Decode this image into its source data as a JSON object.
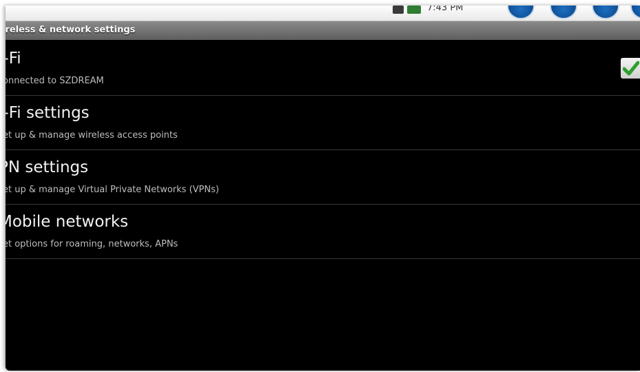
{
  "status_bar": {
    "time": "7:43 PM",
    "icons": [
      "sd-card-icon",
      "battery-icon",
      "nav-circle-icon",
      "nav-circle-icon",
      "nav-circle-icon",
      "nav-circle-icon"
    ]
  },
  "screen": {
    "title": "ireless & network settings"
  },
  "settings": [
    {
      "title": "i-Fi",
      "summary": "onnected to SZDREAM",
      "checked": true
    },
    {
      "title": "i-Fi settings",
      "summary": "et up & manage wireless access points"
    },
    {
      "title": "PN settings",
      "summary": "et up & manage Virtual Private Networks (VPNs)"
    },
    {
      "title": "Mobile networks",
      "summary": "et options for roaming, networks, APNs"
    }
  ],
  "colors": {
    "background": "#000000",
    "title_text": "#f2f2f2",
    "summary_text": "#bdbdbd",
    "check_green": "#2e9e2e",
    "titlebar": "#6e6e6e"
  }
}
